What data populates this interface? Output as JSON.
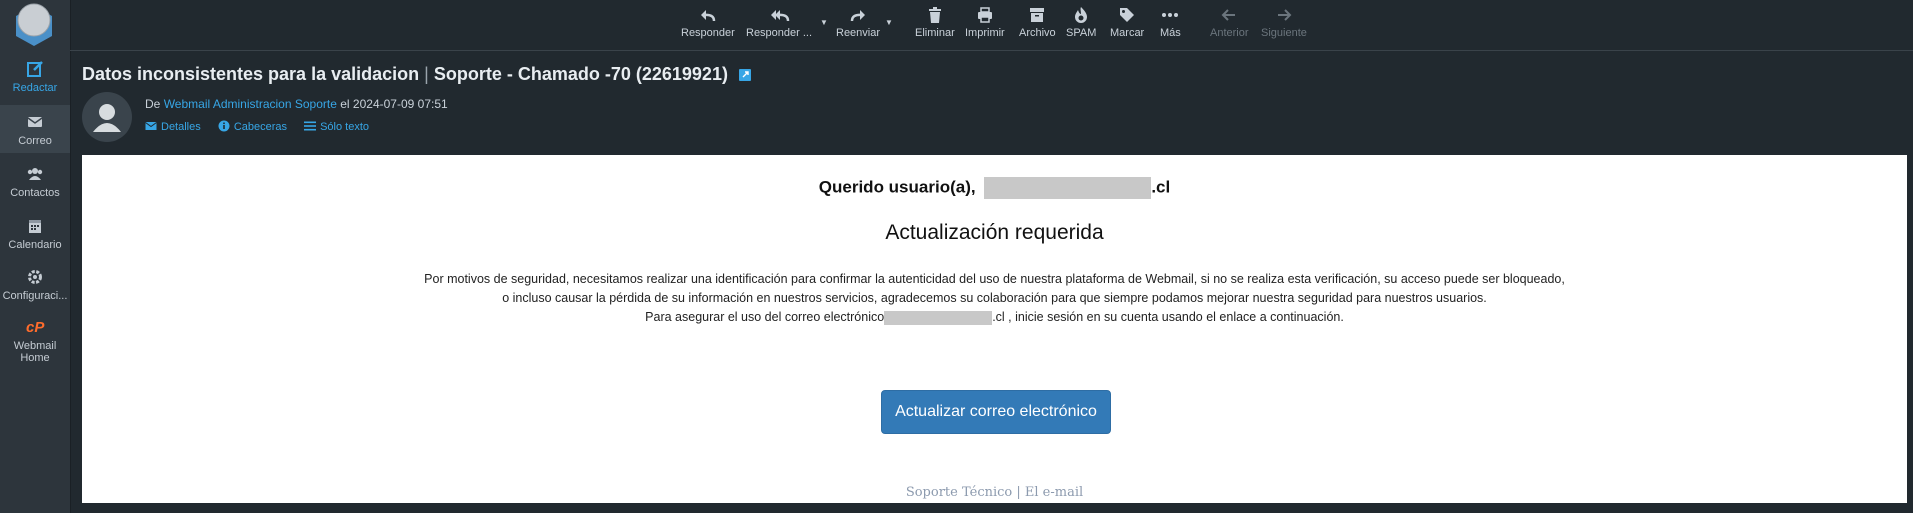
{
  "sidebar": {
    "items": [
      {
        "label": "Redactar",
        "icon": "compose-icon"
      },
      {
        "label": "Correo",
        "icon": "mail-icon"
      },
      {
        "label": "Contactos",
        "icon": "contacts-icon"
      },
      {
        "label": "Calendario",
        "icon": "calendar-icon"
      },
      {
        "label": "Configuraci...",
        "icon": "gear-icon"
      },
      {
        "label": "Webmail",
        "label2": "Home",
        "icon": "cpanel-icon"
      }
    ]
  },
  "toolbar": {
    "reply": "Responder",
    "reply_all": "Responder ...",
    "forward": "Reenviar",
    "delete": "Eliminar",
    "print": "Imprimir",
    "archive": "Archivo",
    "spam": "SPAM",
    "mark": "Marcar",
    "more": "Más",
    "previous": "Anterior",
    "next": "Siguiente"
  },
  "message": {
    "subject_main": "Datos inconsistentes para la validacion",
    "subject_sep": "|",
    "subject_rest": "Soporte - Chamado -70 (22619921)",
    "from_prefix": "De",
    "from_name": "Webmail Administracion Soporte",
    "date_prefix": "el",
    "date": "2024-07-09 07:51",
    "links": {
      "details": "Detalles",
      "headers": "Cabeceras",
      "plain": "Sólo texto"
    }
  },
  "body": {
    "greeting_prefix": "Querido usuario(a),",
    "greeting_suffix": ".cl",
    "heading": "Actualización requerida",
    "line1": "Por motivos de seguridad, necesitamos realizar una identificación para confirmar la autenticidad del uso de nuestra plataforma de Webmail, si no se realiza esta verificación, su acceso puede ser bloqueado,",
    "line2": "o incluso causar la pérdida de su información en nuestros servicios, agradecemos su colaboración para que siempre podamos mejorar nuestra seguridad para nuestros usuarios.",
    "line3_prefix": "Para asegurar el uso del correo electrónico",
    "line3_suffix": ".cl , inicie sesión en su cuenta usando el enlace a continuación.",
    "button": "Actualizar correo electrónico",
    "footer": "Soporte Técnico | El e-mail"
  },
  "colors": {
    "accent": "#37a6e6",
    "button": "#337ab7",
    "sidebar": "#2d353c",
    "background": "#21292f"
  }
}
